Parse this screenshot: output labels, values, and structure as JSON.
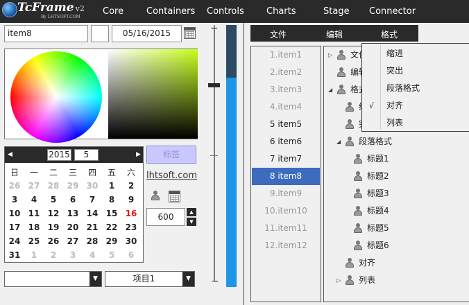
{
  "brand": {
    "name": "TcFrame",
    "version": "v2",
    "sub": "By LHTSOFT.COM"
  },
  "nav": [
    "Core",
    "Containers",
    "Controls",
    "Charts",
    "Stage",
    "Connector"
  ],
  "left": {
    "text_input": "item8",
    "date_input": "05/16/2015",
    "calendar": {
      "year": "2015",
      "month": "5",
      "weekdays": [
        "日",
        "一",
        "二",
        "三",
        "四",
        "五",
        "六"
      ],
      "weeks": [
        [
          "26",
          "27",
          "28",
          "29",
          "30",
          "1",
          "2"
        ],
        [
          "3",
          "4",
          "5",
          "6",
          "7",
          "8",
          "9"
        ],
        [
          "10",
          "11",
          "12",
          "13",
          "14",
          "15",
          "16"
        ],
        [
          "17",
          "18",
          "19",
          "20",
          "21",
          "22",
          "23"
        ],
        [
          "24",
          "25",
          "26",
          "27",
          "28",
          "29",
          "30"
        ],
        [
          "31",
          "1",
          "2",
          "3",
          "4",
          "5",
          "6"
        ]
      ],
      "dim_first_row": [
        "26",
        "27",
        "28",
        "29",
        "30"
      ],
      "selected_day": "16"
    },
    "label_button": "标签",
    "link": "lhtsoft.com",
    "spinner_value": "600",
    "combo1_value": "",
    "combo2_value": "项目1",
    "slider_level": 0.22,
    "progress_fill": 0.8
  },
  "menubar": [
    "文件",
    "编辑",
    "格式"
  ],
  "list": {
    "items": [
      "1.item1",
      "2.item2",
      "3.item3",
      "4.item4",
      "5 item5",
      "6 item6",
      "7 item7",
      "8 item8",
      "9.item9",
      "10.item10",
      "11.item11",
      "12.item12"
    ],
    "selected_index": 7
  },
  "tree": {
    "items": [
      {
        "label": "文件",
        "toggle": "▷"
      },
      {
        "label": "编辑",
        "toggle": ""
      },
      {
        "label": "格式",
        "toggle": "◢"
      },
      {
        "label": "缩进",
        "toggle": ""
      },
      {
        "label": "突出",
        "toggle": ""
      },
      {
        "label": "段落格式",
        "toggle": "◢"
      },
      {
        "label": "标题1",
        "toggle": ""
      },
      {
        "label": "标题2",
        "toggle": ""
      },
      {
        "label": "标题3",
        "toggle": ""
      },
      {
        "label": "标题4",
        "toggle": ""
      },
      {
        "label": "标题5",
        "toggle": ""
      },
      {
        "label": "标题6",
        "toggle": ""
      },
      {
        "label": "对齐",
        "toggle": ""
      },
      {
        "label": "列表",
        "toggle": "▷"
      }
    ]
  },
  "dropdown": {
    "items": [
      "缩进",
      "突出",
      "段落格式",
      "对齐",
      "列表"
    ],
    "checked_index": 3,
    "check_mark": "√"
  },
  "colors": {
    "accent": "#1f95e8",
    "selected": "#3d6cbf",
    "dark": "#2a2a2a",
    "holiday": "#e11111"
  }
}
